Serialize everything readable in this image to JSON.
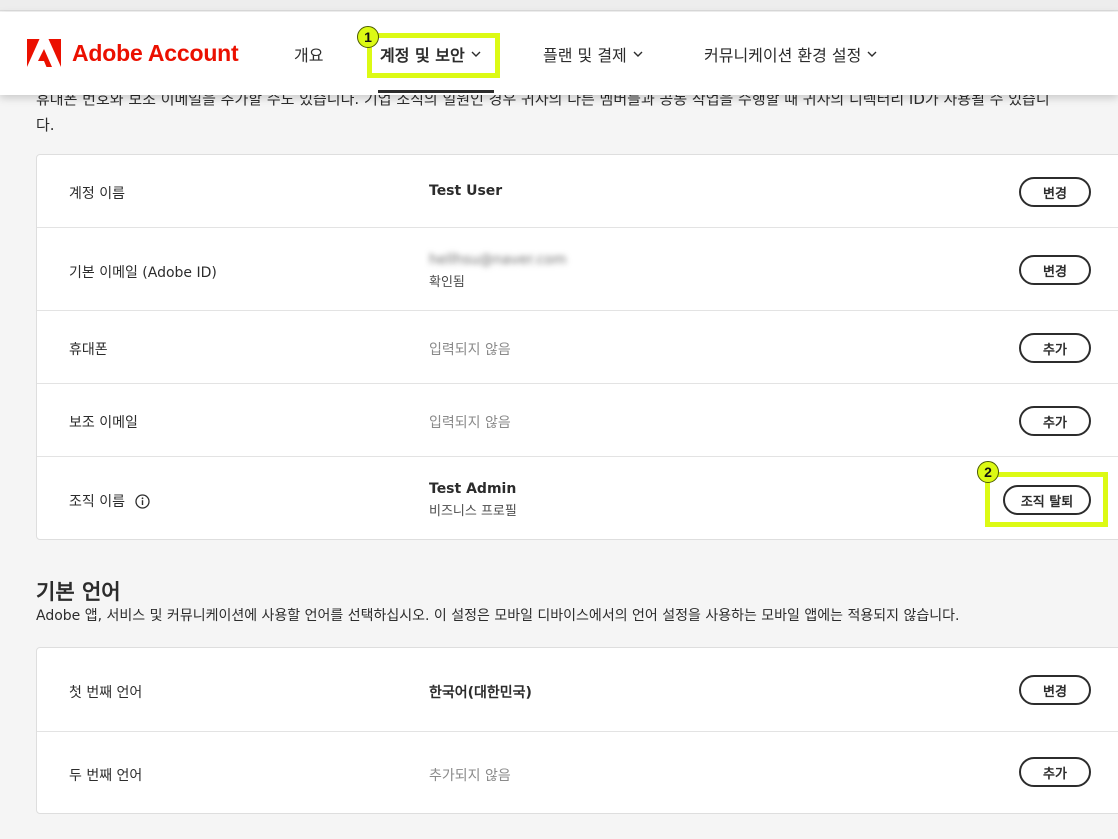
{
  "header": {
    "brand": "Adobe Account",
    "nav": [
      {
        "label": "개요"
      },
      {
        "label": "계정 및 보안"
      },
      {
        "label": "플랜 및 결제"
      },
      {
        "label": "커뮤니케이션 환경 설정"
      }
    ]
  },
  "annotations": {
    "badge1": "1",
    "badge2": "2"
  },
  "intro": {
    "line1": "휴대폰 번호와 보조 이메일을 추가할 수도 있습니다. 기업 조직의 일원인 경우 귀사의 다른 멤버들과 공동 작업을 수행할 때 귀사의 디렉터리 ID가 사용될 수 있습니",
    "line2": "다."
  },
  "account": {
    "rows": [
      {
        "label": "계정 이름",
        "value": "Test User",
        "button": "변경"
      },
      {
        "label": "기본 이메일 (Adobe ID)",
        "value": "hellhsu@naver.com",
        "sub": "확인됨",
        "button": "변경"
      },
      {
        "label": "휴대폰",
        "value": "입력되지 않음",
        "button": "추가"
      },
      {
        "label": "보조 이메일",
        "value": "입력되지 않음",
        "button": "추가"
      },
      {
        "label": "조직 이름",
        "value": "Test Admin",
        "sub": "비즈니스 프로필",
        "button": "조직 탈퇴"
      }
    ]
  },
  "language": {
    "title": "기본 언어",
    "description": "Adobe 앱, 서비스 및 커뮤니케이션에 사용할 언어를 선택하십시오. 이 설정은 모바일 디바이스에서의 언어 설정을 사용하는 모바일 앱에는 적용되지 않습니다.",
    "rows": [
      {
        "label": "첫 번째 언어",
        "value": "한국어(대한민국)",
        "button": "변경"
      },
      {
        "label": "두 번째 언어",
        "value": "추가되지 않음",
        "button": "추가"
      }
    ]
  },
  "colors": {
    "brand": "#eb1000",
    "highlight": "#dcfa14"
  },
  "icons": {
    "logo": "adobe-logo-icon",
    "info": "info-icon",
    "chevron": "chevron-down-icon"
  }
}
